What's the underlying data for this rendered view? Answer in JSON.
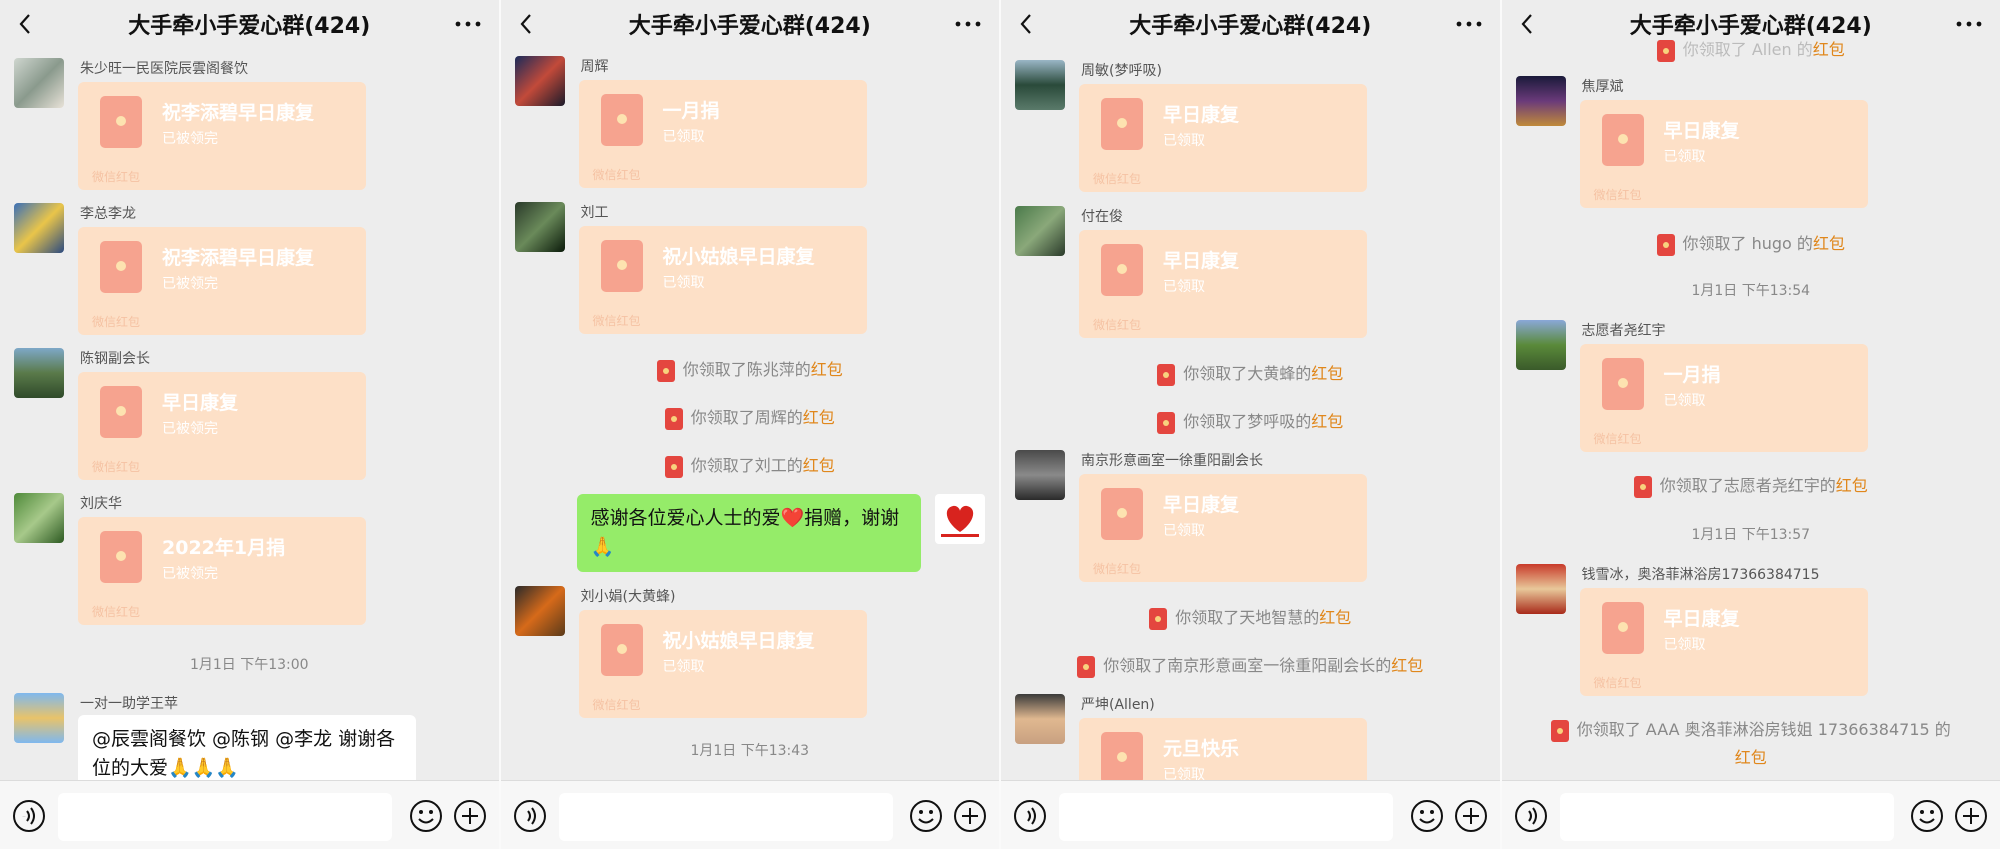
{
  "header": {
    "title": "大手牵小手爱心群(424)"
  },
  "common": {
    "rp_sub_claimed_all": "已被领完",
    "rp_sub_claimed": "已领取",
    "rp_foot": "微信红包",
    "hongbao": "红包"
  },
  "panels": [
    {
      "messages": [
        {
          "sender": "朱少旺一民医院辰雲阁餐饮",
          "rp": "祝李添碧早日康复",
          "sub": "已被领完"
        },
        {
          "sender": "李总李龙",
          "rp": "祝李添碧早日康复",
          "sub": "已被领完"
        },
        {
          "sender": "陈钢副会长",
          "rp": "早日康复",
          "sub": "已被领完"
        },
        {
          "sender": "刘庆华",
          "rp": "2022年1月捐",
          "sub": "已被领完"
        }
      ],
      "time": "1月1日 下午13:00",
      "text_sender": "一对一助学王苹",
      "text": "@辰雲阁餐饮  @陈钢  @李龙  谢谢各位的大爱🙏🙏🙏"
    },
    {
      "messages": [
        {
          "sender": "周辉",
          "rp": "一月捐",
          "sub": "已领取"
        },
        {
          "sender": "刘工",
          "rp": "祝小姑娘早日康复",
          "sub": "已领取"
        }
      ],
      "notices": [
        {
          "pre": "你领取了陈兆萍的",
          "hb": "红包"
        },
        {
          "pre": "你领取了周辉的",
          "hb": "红包"
        },
        {
          "pre": "你领取了刘工的",
          "hb": "红包"
        }
      ],
      "self_text": "感谢各位爱心人士的爱❤️捐赠，谢谢🙏",
      "msg3": {
        "sender": "刘小娟(大黄蜂)",
        "rp": "祝小姑娘早日康复",
        "sub": "已领取"
      },
      "time": "1月1日 下午13:43"
    },
    {
      "messages": [
        {
          "sender": "周敏(梦呼吸)",
          "rp": "早日康复",
          "sub": "已领取"
        },
        {
          "sender": "付在俊",
          "rp": "早日康复",
          "sub": "已领取"
        }
      ],
      "notices": [
        {
          "pre": "你领取了大黄蜂的",
          "hb": "红包"
        },
        {
          "pre": "你领取了梦呼吸的",
          "hb": "红包"
        }
      ],
      "msg3": {
        "sender": "南京形意画室一徐重阳副会长",
        "rp": "早日康复",
        "sub": "已领取"
      },
      "notices2": [
        {
          "pre": "你领取了天地智慧的",
          "hb": "红包"
        },
        {
          "pre": "你领取了南京形意画室一徐重阳副会长的",
          "hb": "红包"
        }
      ],
      "msg4": {
        "sender": "严坤(Allen)",
        "rp": "元旦快乐",
        "sub": "已领取"
      }
    },
    {
      "top_partial": "你领取了 Allen 的",
      "messages": [
        {
          "sender": "焦厚斌",
          "rp": "早日康复",
          "sub": "已领取"
        }
      ],
      "notice1": {
        "pre": "你领取了 hugo 的",
        "hb": "红包"
      },
      "time1": "1月1日 下午13:54",
      "msg2": {
        "sender": "志愿者尧红宇",
        "rp": "一月捐",
        "sub": "已领取"
      },
      "notice2": {
        "pre": "你领取了志愿者尧红宇的",
        "hb": "红包"
      },
      "time2": "1月1日 下午13:57",
      "msg3": {
        "sender": "钱雪冰，奥洛菲淋浴房17366384715",
        "rp": "早日康复",
        "sub": "已领取"
      },
      "notice3": {
        "pre": "你领取了 AAA 奥洛菲淋浴房钱姐 17366384715 的",
        "hb": "红包"
      }
    }
  ],
  "colors": {
    "accent_link": "#e0871c",
    "self_bubble": "#95ec69",
    "redpacket_bg": "#fde0c7"
  }
}
